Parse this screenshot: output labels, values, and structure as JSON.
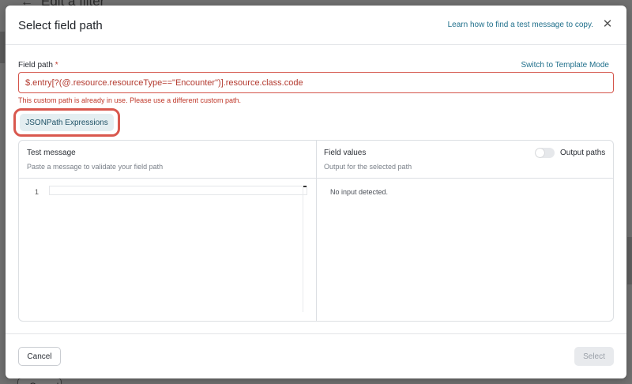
{
  "background": {
    "page_title": "Edit a filter",
    "back_glyph": "←",
    "cancel_label": "Cancel"
  },
  "modal": {
    "title": "Select field path",
    "learn_link": "Learn how to find a test message to copy.",
    "close_icon": "close-icon",
    "close_glyph": "✕"
  },
  "field_path": {
    "label": "Field path",
    "required_marker": "*",
    "switch_link": "Switch to Template Mode",
    "value": "$.entry[?(@.resource.resourceType==\"Encounter\")].resource.class.code",
    "error": "This custom path is already in use. Please use a different custom path.",
    "jsonpath_button": "JSONPath Expressions"
  },
  "test_message": {
    "title": "Test message",
    "subtitle": "Paste a message to validate your field path",
    "line_number": "1"
  },
  "field_values": {
    "title": "Field values",
    "subtitle": "Output for the selected path",
    "toggle_label": "Output paths",
    "toggle_on": false,
    "empty_text": "No input detected."
  },
  "footer": {
    "cancel_label": "Cancel",
    "select_label": "Select"
  },
  "colors": {
    "error": "#c0392b",
    "link": "#1f6f8b",
    "highlight": "#d9584e"
  }
}
